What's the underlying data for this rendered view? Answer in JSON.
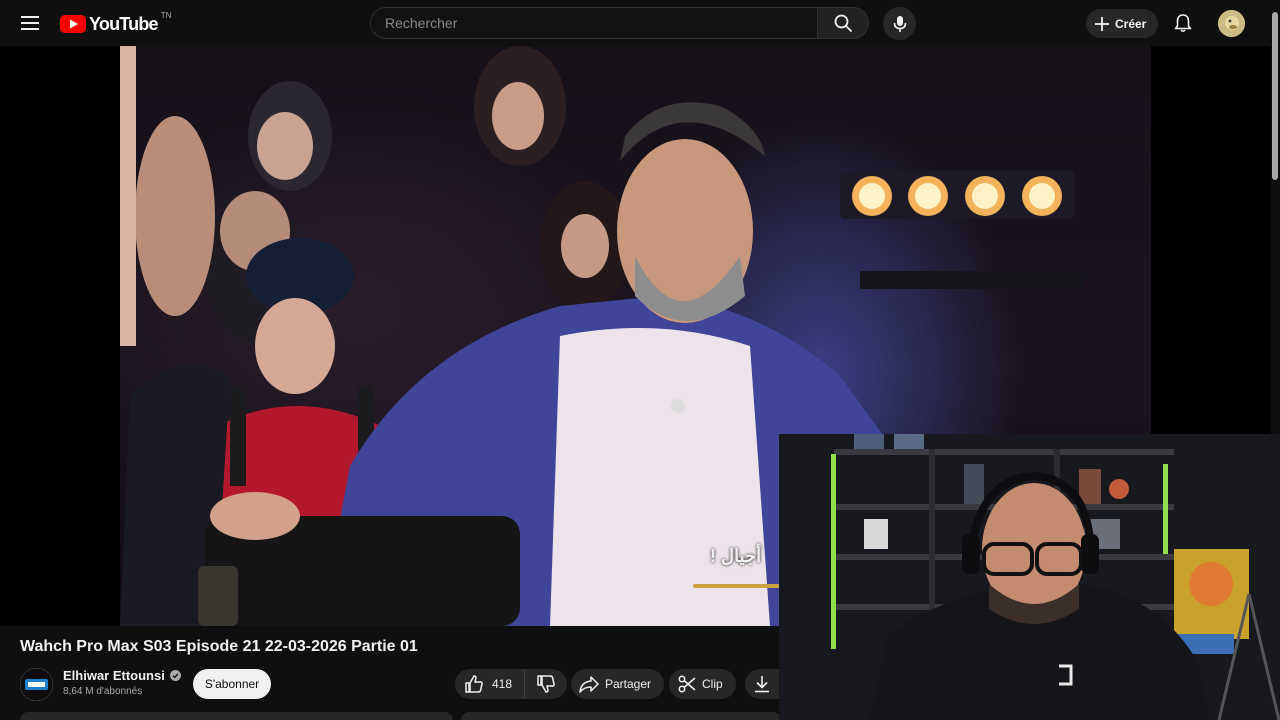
{
  "header": {
    "logo_text": "YouTube",
    "country_code": "TN",
    "search_placeholder": "Rechercher",
    "create_label": "Créer"
  },
  "video": {
    "subtitle_text": "أجيال !",
    "title": "Wahch Pro Max S03 Episode 21 22-03-2026 Partie 01"
  },
  "channel": {
    "name": "Elhiwar Ettounsi",
    "subscribers": "8,64 M d'abonnés",
    "subscribe_label": "S'abonner"
  },
  "actions": {
    "like_count": "418",
    "share_label": "Partager",
    "clip_label": "Clip"
  },
  "colors": {
    "background": "#0f0f0f",
    "brand_red": "#ff0000",
    "pill_bg": "#272727",
    "subscribe_bg": "#f1f1f1"
  }
}
